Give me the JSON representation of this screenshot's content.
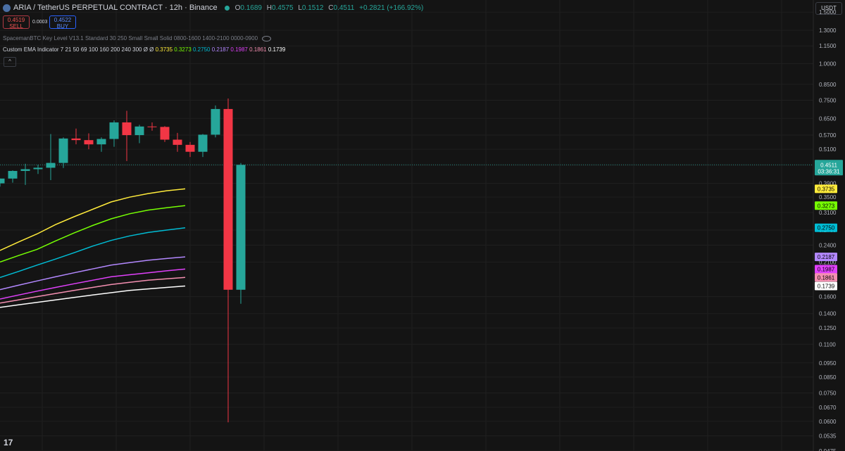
{
  "header": {
    "title": "ARIA / TetherUS PERPETUAL CONTRACT · 12h · Binance",
    "o_label": "O",
    "o_value": "0.1689",
    "h_label": "H",
    "h_value": "0.4575",
    "l_label": "L",
    "l_value": "0.1512",
    "c_label": "C",
    "c_value": "0.4511",
    "change": "+0.2821 (+166.92%)"
  },
  "trade": {
    "sell_price": "0.4519",
    "sell_label": "SELL",
    "spread": "0.0003",
    "buy_price": "0.4522",
    "buy_label": "BUY"
  },
  "indicators": {
    "key_level": "SpacemanBTC Key Level V13.1 Standard 30 250 Small Small Solid 0800-1600 1400-2100 0000-0900",
    "ema_label": "Custom EMA Indicator 7 21 50 69 100 160 200 240 300 Ø Ø",
    "ema_values": [
      "0.3735",
      "0.3273",
      "0.2750",
      "0.2187",
      "0.1987",
      "0.1861",
      "0.1739"
    ]
  },
  "currency": "USDT",
  "collapse_icon": "chevron-up-icon",
  "logo_icon": "tradingview-logo",
  "colors": {
    "background": "#141414",
    "up": "#26a69a",
    "down": "#f23645",
    "grid": "#1f1f1f",
    "ema": [
      "#ffeb3b",
      "#76ff03",
      "#00bcd4",
      "#b388ff",
      "#e040fb",
      "#f48fb1",
      "#ffffff"
    ]
  },
  "price_label": {
    "price": "0.4511",
    "countdown": "03:36:31"
  },
  "chart_data": {
    "type": "candlestick",
    "y_scale": "log",
    "ylim": [
      0.0475,
      1.65
    ],
    "y_ticks": [
      "1.5000",
      "1.3000",
      "1.1500",
      "1.0000",
      "0.8500",
      "0.7500",
      "0.6500",
      "0.5700",
      "0.5100",
      "0.4500",
      "0.3900",
      "0.3500",
      "0.3100",
      "0.2700",
      "0.2400",
      "0.2100",
      "0.1600",
      "0.1400",
      "0.1250",
      "0.1100",
      "0.0950",
      "0.0850",
      "0.0750",
      "0.0670",
      "0.0600",
      "0.0535",
      "0.0475"
    ],
    "candles": [
      {
        "o": 0.39,
        "h": 0.405,
        "l": 0.38,
        "c": 0.405
      },
      {
        "o": 0.405,
        "h": 0.432,
        "l": 0.392,
        "c": 0.43
      },
      {
        "o": 0.43,
        "h": 0.455,
        "l": 0.385,
        "c": 0.436
      },
      {
        "o": 0.436,
        "h": 0.452,
        "l": 0.42,
        "c": 0.441
      },
      {
        "o": 0.441,
        "h": 0.575,
        "l": 0.4,
        "c": 0.458
      },
      {
        "o": 0.458,
        "h": 0.56,
        "l": 0.44,
        "c": 0.555
      },
      {
        "o": 0.555,
        "h": 0.6,
        "l": 0.53,
        "c": 0.548
      },
      {
        "o": 0.548,
        "h": 0.578,
        "l": 0.51,
        "c": 0.53
      },
      {
        "o": 0.53,
        "h": 0.56,
        "l": 0.5,
        "c": 0.553
      },
      {
        "o": 0.553,
        "h": 0.64,
        "l": 0.52,
        "c": 0.63
      },
      {
        "o": 0.63,
        "h": 0.69,
        "l": 0.465,
        "c": 0.57
      },
      {
        "o": 0.57,
        "h": 0.618,
        "l": 0.535,
        "c": 0.61
      },
      {
        "o": 0.61,
        "h": 0.63,
        "l": 0.59,
        "c": 0.608
      },
      {
        "o": 0.608,
        "h": 0.612,
        "l": 0.54,
        "c": 0.55
      },
      {
        "o": 0.55,
        "h": 0.58,
        "l": 0.5,
        "c": 0.528
      },
      {
        "o": 0.528,
        "h": 0.54,
        "l": 0.48,
        "c": 0.5
      },
      {
        "o": 0.5,
        "h": 0.575,
        "l": 0.48,
        "c": 0.572
      },
      {
        "o": 0.572,
        "h": 0.72,
        "l": 0.56,
        "c": 0.7
      },
      {
        "o": 0.7,
        "h": 0.76,
        "l": 0.0595,
        "c": 0.1689
      },
      {
        "o": 0.1689,
        "h": 0.4575,
        "l": 0.1512,
        "c": 0.4511
      }
    ],
    "ema_series": [
      {
        "name": "EMA 7",
        "color": "#ffeb3b",
        "values": [
          0.23,
          0.246,
          0.262,
          0.282,
          0.3,
          0.318,
          0.337,
          0.35,
          0.36,
          0.368,
          0.3735
        ]
      },
      {
        "name": "EMA 21",
        "color": "#76ff03",
        "values": [
          0.21,
          0.221,
          0.232,
          0.248,
          0.264,
          0.28,
          0.295,
          0.307,
          0.316,
          0.322,
          0.3273
        ]
      },
      {
        "name": "EMA 50",
        "color": "#00bcd4",
        "values": [
          0.186,
          0.195,
          0.205,
          0.215,
          0.226,
          0.238,
          0.249,
          0.258,
          0.265,
          0.27,
          0.275
        ]
      },
      {
        "name": "EMA 69",
        "color": "#b388ff",
        "values": [
          0.169,
          0.175,
          0.181,
          0.187,
          0.193,
          0.199,
          0.205,
          0.209,
          0.213,
          0.216,
          0.2187
        ]
      },
      {
        "name": "EMA 100",
        "color": "#e040fb",
        "values": [
          0.157,
          0.162,
          0.167,
          0.172,
          0.177,
          0.182,
          0.187,
          0.19,
          0.193,
          0.196,
          0.1987
        ]
      },
      {
        "name": "EMA 160",
        "color": "#f48fb1",
        "values": [
          0.152,
          0.156,
          0.16,
          0.164,
          0.168,
          0.172,
          0.176,
          0.179,
          0.182,
          0.184,
          0.1861
        ]
      },
      {
        "name": "EMA 200",
        "color": "#ffffff",
        "values": [
          0.147,
          0.15,
          0.153,
          0.156,
          0.159,
          0.162,
          0.165,
          0.168,
          0.17,
          0.172,
          0.1739
        ]
      }
    ],
    "current_price": 0.4511
  }
}
